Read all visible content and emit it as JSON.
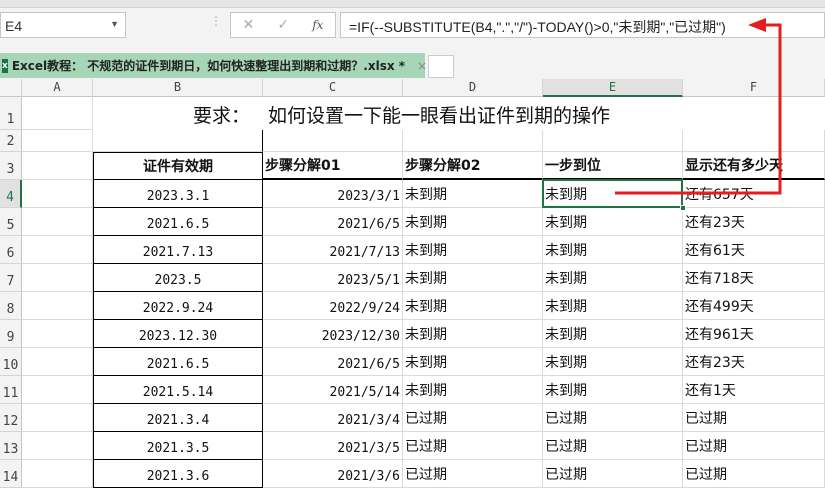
{
  "name_box": "E4",
  "formula_buttons": {
    "cancel": "✕",
    "enter": "✓",
    "fx": "fx"
  },
  "formula": "=IF(--SUBSTITUTE(B4,\".\",\"/\")-TODAY()>0,\"未到期\",\"已过期\")",
  "tab": {
    "title": "Excel教程： 不规范的证件到期日，如何快速整理出到期和过期？.xlsx *",
    "close": "×",
    "icon": "excel-icon"
  },
  "columns": [
    "A",
    "B",
    "C",
    "D",
    "E",
    "F"
  ],
  "selected_column": "E",
  "rows": [
    "1",
    "2",
    "3",
    "4",
    "5",
    "6",
    "7",
    "8",
    "9",
    "10",
    "11",
    "12",
    "13",
    "14"
  ],
  "title_row": {
    "label": "要求：",
    "text": "如何设置一下能一眼看出证件到期的操作"
  },
  "headers": [
    "证件有效期",
    "步骤分解01",
    "步骤分解02",
    "一步到位",
    "显示还有多少天"
  ],
  "data": [
    [
      "2023.3.1",
      "2023/3/1",
      "未到期",
      "未到期",
      "还有657天"
    ],
    [
      "2021.6.5",
      "2021/6/5",
      "未到期",
      "未到期",
      "还有23天"
    ],
    [
      "2021.7.13",
      "2021/7/13",
      "未到期",
      "未到期",
      "还有61天"
    ],
    [
      "2023.5",
      "2023/5/1",
      "未到期",
      "未到期",
      "还有718天"
    ],
    [
      "2022.9.24",
      "2022/9/24",
      "未到期",
      "未到期",
      "还有499天"
    ],
    [
      "2023.12.30",
      "2023/12/30",
      "未到期",
      "未到期",
      "还有961天"
    ],
    [
      "2021.6.5",
      "2021/6/5",
      "未到期",
      "未到期",
      "还有23天"
    ],
    [
      "2021.5.14",
      "2021/5/14",
      "未到期",
      "未到期",
      "还有1天"
    ],
    [
      "2021.3.4",
      "2021/3/4",
      "已过期",
      "已过期",
      "已过期"
    ],
    [
      "2021.3.5",
      "2021/3/5",
      "已过期",
      "已过期",
      "已过期"
    ],
    [
      "2021.3.6",
      "2021/3/6",
      "已过期",
      "已过期",
      "已过期"
    ]
  ],
  "colors": {
    "accent": "#217346",
    "tab": "#a6d6b6",
    "arrow": "#e41e1e"
  }
}
